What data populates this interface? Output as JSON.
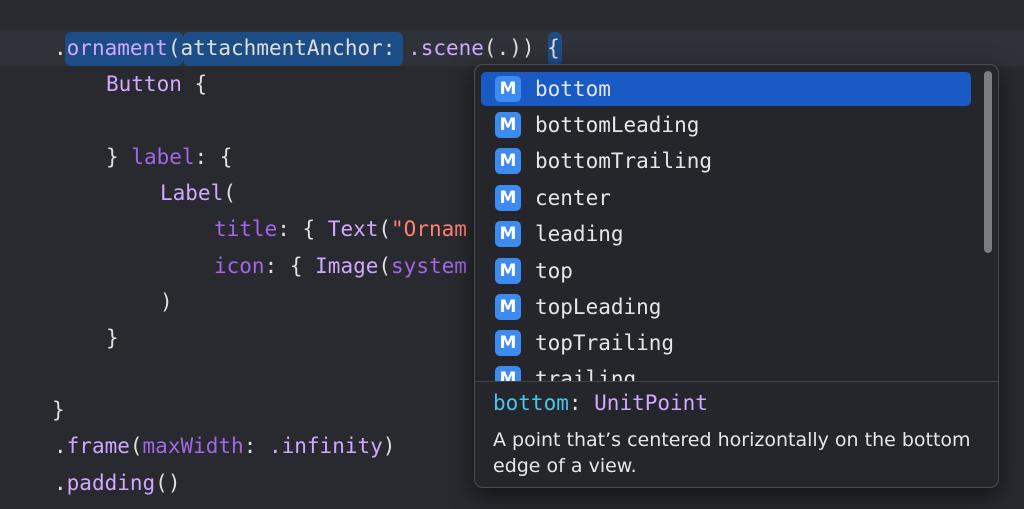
{
  "code": {
    "l0": "}",
    "l1_dot": ".",
    "l1_ornament": "ornament",
    "l1_paren": "(",
    "l1_param": "attachmentAnchor",
    "l1_colon": ": ",
    "l1_scene": ".scene",
    "l1_args": "(.)",
    "l1_close": ")",
    "l1_brace": " {",
    "l2": "Button",
    "l2_brace": " {",
    "l4_brace": "} ",
    "l4_label": "label",
    "l4_rest": ": {",
    "l5": "Label",
    "l5_paren": "(",
    "l6_title": "title",
    "l6_mid": ": { ",
    "l6_text": "Text",
    "l6_paren": "(",
    "l6_str": "\"Ornam",
    "l7_icon": "icon",
    "l7_mid": ": { ",
    "l7_image": "Image",
    "l7_paren": "(",
    "l7_system": "system",
    "l8": ")",
    "l9": "}",
    "l11": "}",
    "l12_dot": ".",
    "l12_frame": "frame",
    "l12_paren": "(",
    "l12_param": "maxWidth",
    "l12_colon": ": ",
    "l12_inf": ".infinity",
    "l12_close": ")",
    "l13_dot": ".",
    "l13_padding": "padding",
    "l13_parens": "()"
  },
  "completion": {
    "items": [
      {
        "badge": "M",
        "label": "bottom"
      },
      {
        "badge": "M",
        "label": "bottomLeading"
      },
      {
        "badge": "M",
        "label": "bottomTrailing"
      },
      {
        "badge": "M",
        "label": "center"
      },
      {
        "badge": "M",
        "label": "leading"
      },
      {
        "badge": "M",
        "label": "top"
      },
      {
        "badge": "M",
        "label": "topLeading"
      },
      {
        "badge": "M",
        "label": "topTrailing"
      },
      {
        "badge": "M",
        "label": "trailing"
      }
    ],
    "selected_index": 0,
    "doc": {
      "name": "bottom",
      "colon": ": ",
      "type": "UnitPoint",
      "description": "A point that’s centered horizontally on the bottom edge of a view."
    }
  },
  "colors": {
    "background": "#292a30",
    "selection": "#1a5ac5",
    "badge": "#3d8bf0"
  }
}
